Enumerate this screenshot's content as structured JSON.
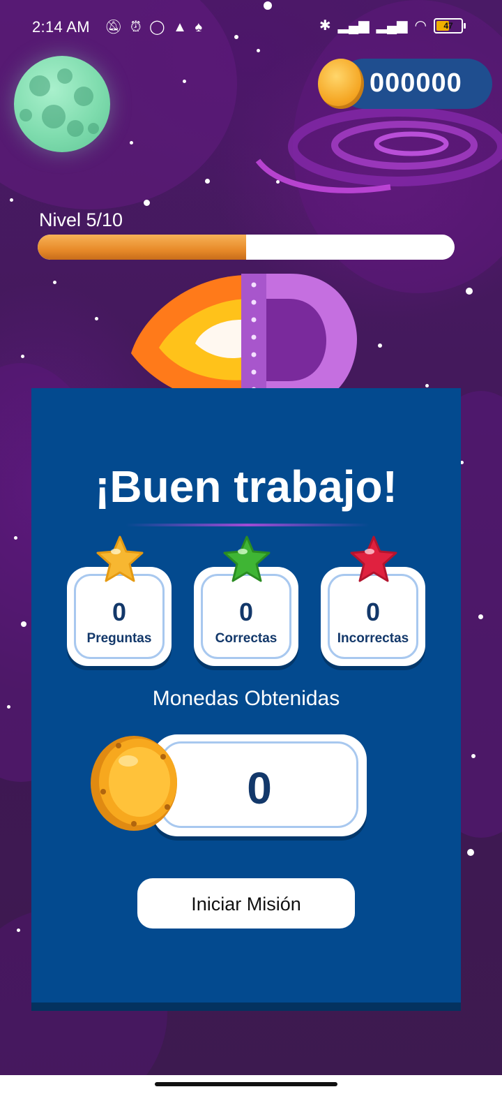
{
  "status_bar": {
    "time": "2:14 AM",
    "battery": "47",
    "left_icons": [
      "muted-notification-icon",
      "alarm-icon",
      "whatsapp-icon",
      "app-icon",
      "app-icon-2"
    ],
    "right_icons": [
      "bluetooth-icon",
      "signal-icon",
      "signal-icon-2",
      "wifi-icon",
      "battery-icon"
    ]
  },
  "header": {
    "coins": "000000"
  },
  "level": {
    "label": "Nivel 5/10",
    "progress": 0.5
  },
  "result": {
    "title": "¡Buen trabajo!",
    "stats": [
      {
        "value": "0",
        "label": "Preguntas",
        "star_color": "#f7b731"
      },
      {
        "value": "0",
        "label": "Correctas",
        "star_color": "#3fb534"
      },
      {
        "value": "0",
        "label": "Incorrectas",
        "star_color": "#e0213f"
      }
    ],
    "coins_label": "Monedas Obtenidas",
    "coins_value": "0",
    "start_button": "Iniciar Misión"
  },
  "colors": {
    "card": "#034a8f",
    "text_dark": "#13386a",
    "progress": "#e88b2a"
  }
}
